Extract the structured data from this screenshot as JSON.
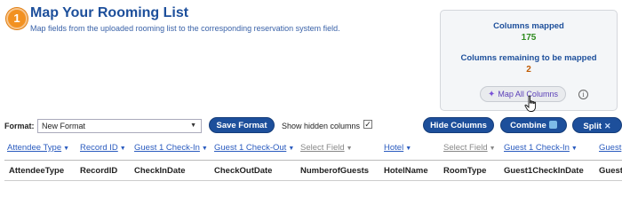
{
  "header": {
    "step_number": "1",
    "title": "Map Your Rooming List",
    "subtitle": "Map fields from the uploaded rooming list to the corresponding reservation system field."
  },
  "stats": {
    "mapped_label": "Columns mapped",
    "mapped_value": "175",
    "remaining_label": "Columns remaining to be mapped",
    "remaining_value": "2",
    "map_all_label": "Map All Columns",
    "mapped_color": "#2e8b1e",
    "remaining_color": "#c05a00"
  },
  "toolbar": {
    "format_label": "Format:",
    "format_value": "New Format",
    "save_format_label": "Save Format",
    "show_hidden_label": "Show hidden columns",
    "show_hidden_checked": true,
    "hide_columns_label": "Hide Columns",
    "combine_label": "Combine",
    "split_label": "Split"
  },
  "mapping_headers": [
    {
      "label": "Attendee Type",
      "mapped": true
    },
    {
      "label": "Record ID",
      "mapped": true
    },
    {
      "label": "Guest 1 Check-In",
      "mapped": true
    },
    {
      "label": "Guest 1 Check-Out",
      "mapped": true
    },
    {
      "label": "Select Field",
      "mapped": false
    },
    {
      "label": "Hotel",
      "mapped": true
    },
    {
      "label": "Select Field",
      "mapped": false
    },
    {
      "label": "Guest 1 Check-In",
      "mapped": true
    },
    {
      "label": "Guest",
      "mapped": true
    }
  ],
  "source_columns": [
    "AttendeeType",
    "RecordID",
    "CheckInDate",
    "CheckOutDate",
    "NumberofGuests",
    "HotelName",
    "RoomType",
    "Guest1CheckInDate",
    "Guest"
  ]
}
